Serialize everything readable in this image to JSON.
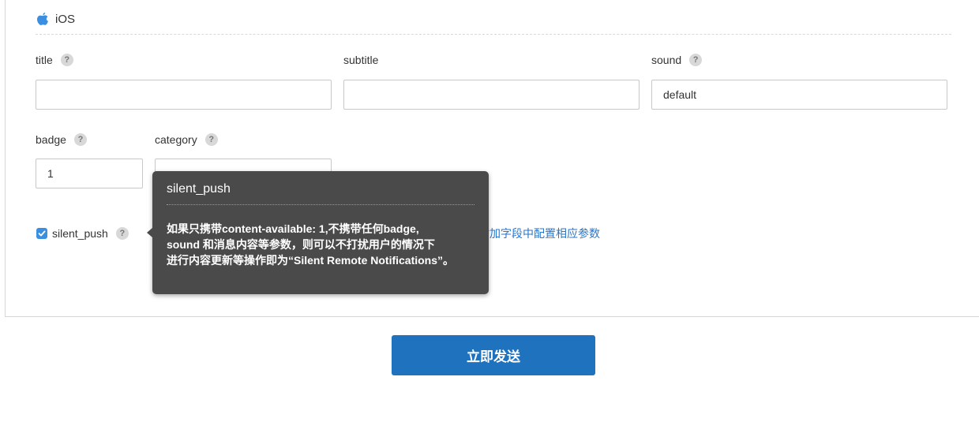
{
  "section": {
    "title": "iOS",
    "icon": "apple-icon"
  },
  "fields": {
    "title": {
      "label": "title",
      "value": ""
    },
    "subtitle": {
      "label": "subtitle",
      "value": ""
    },
    "sound": {
      "label": "sound",
      "value": "default"
    },
    "badge": {
      "label": "badge",
      "value": "1"
    },
    "category": {
      "label": "category",
      "value": ""
    }
  },
  "help_glyph": "?",
  "silent_push": {
    "label": "silent_push",
    "checked": true
  },
  "extra_link": "请在附加字段中配置相应参数",
  "tooltip": {
    "title": "silent_push",
    "lines": [
      "如果只携带content-available: 1,不携带任何badge,",
      "sound 和消息内容等参数，则可以不打扰用户的情况下",
      "进行内容更新等操作即为“Silent Remote Notifications”。"
    ]
  },
  "send_button": "立即发送",
  "colors": {
    "accent": "#1f73be",
    "checkbox": "#3a8fe0",
    "tooltip_bg": "#4a4a4a",
    "link": "#2a77c9"
  }
}
